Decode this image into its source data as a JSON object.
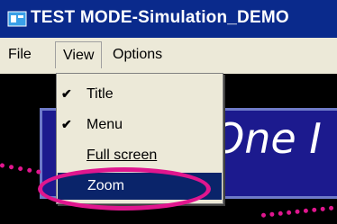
{
  "window": {
    "title": "TEST MODE-Simulation_DEMO",
    "icon": "app-icon"
  },
  "menubar": {
    "items": [
      "File",
      "View",
      "Options"
    ]
  },
  "view_menu": {
    "items": [
      {
        "label": "Title",
        "checked": true
      },
      {
        "label": "Menu",
        "checked": true
      },
      {
        "label": "Full screen",
        "checked": false
      },
      {
        "label": "Zoom",
        "checked": false,
        "highlighted": true
      }
    ],
    "check_glyph": "✔"
  },
  "content": {
    "panel_text": "One I"
  },
  "colors": {
    "titlebar": "#0a2a8c",
    "menu_highlight": "#0a246a",
    "annotation": "#e0168e",
    "panel": "#1c1a8e"
  }
}
